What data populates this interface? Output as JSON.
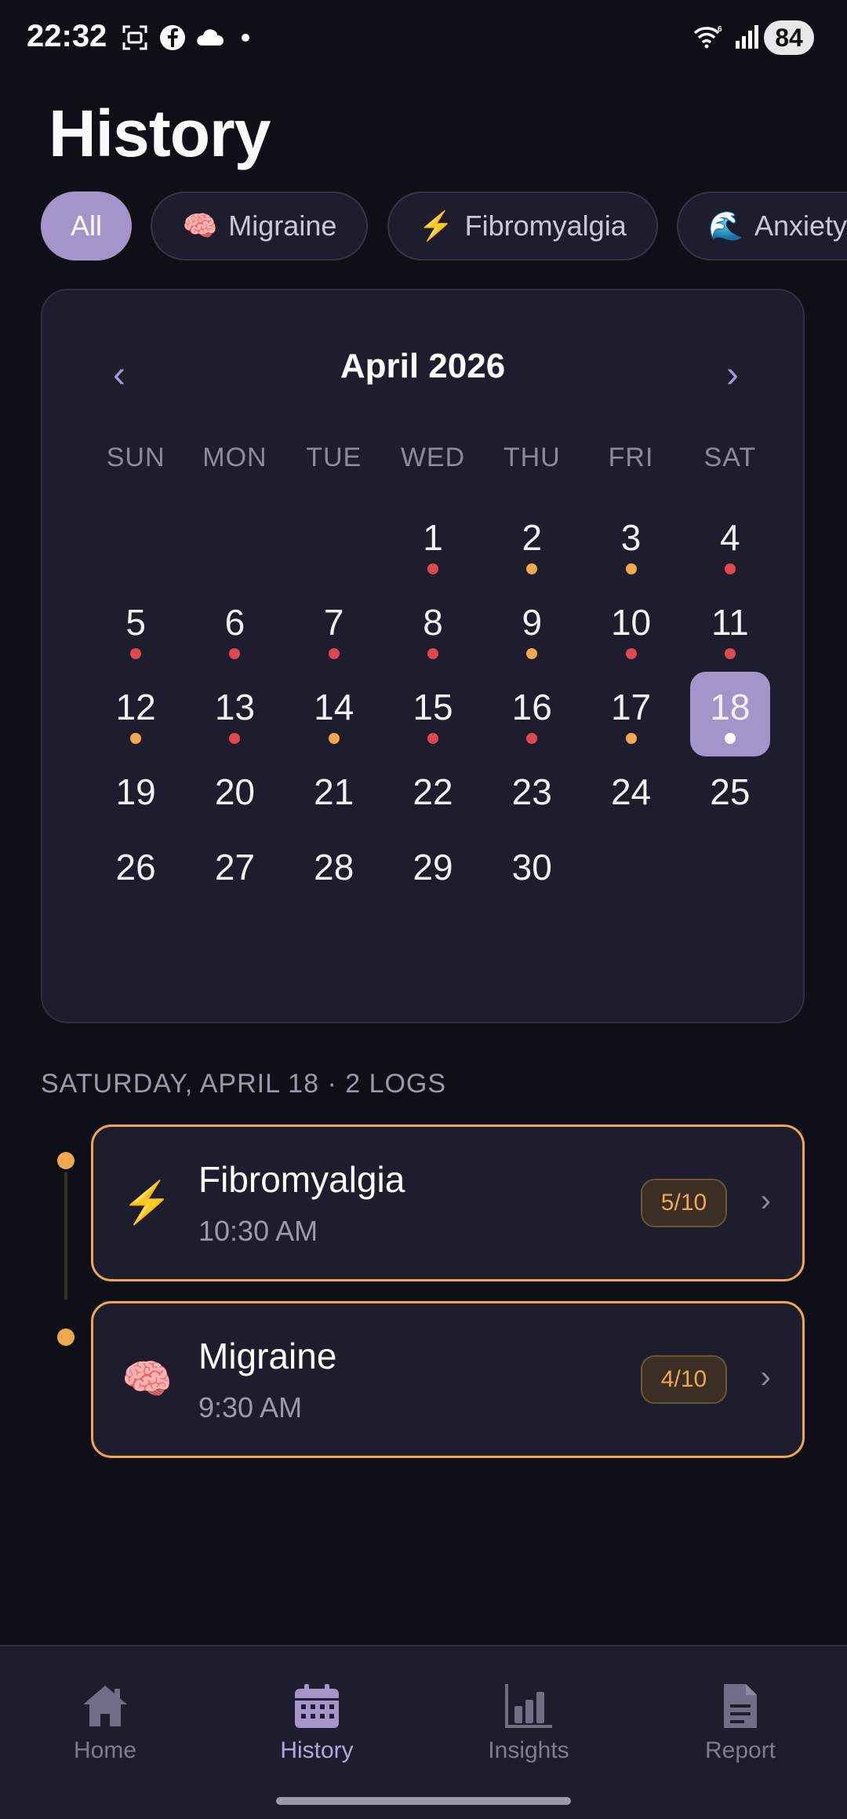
{
  "status_bar": {
    "time": "22:32",
    "battery": "84",
    "icons": [
      "screenshot-icon",
      "facebook-icon",
      "cloud-icon",
      "dot-icon",
      "wifi-6-icon",
      "signal-icon"
    ]
  },
  "page": {
    "title": "History"
  },
  "filters": [
    {
      "label": "All",
      "emoji": "",
      "active": true
    },
    {
      "label": "Migraine",
      "emoji": "🧠",
      "active": false
    },
    {
      "label": "Fibromyalgia",
      "emoji": "⚡",
      "active": false
    },
    {
      "label": "Anxiety",
      "emoji": "🌊",
      "active": false
    }
  ],
  "calendar": {
    "month": "April 2026",
    "prev": "‹",
    "next": "›",
    "weekdays": [
      "SUN",
      "MON",
      "TUE",
      "WED",
      "THU",
      "FRI",
      "SAT"
    ],
    "selected_day": "18",
    "weeks": [
      [
        {
          "d": ""
        },
        {
          "d": ""
        },
        {
          "d": ""
        },
        {
          "d": "1",
          "dot": "red"
        },
        {
          "d": "2",
          "dot": "orange"
        },
        {
          "d": "3",
          "dot": "orange"
        },
        {
          "d": "4",
          "dot": "red"
        }
      ],
      [
        {
          "d": "5",
          "dot": "red"
        },
        {
          "d": "6",
          "dot": "red"
        },
        {
          "d": "7",
          "dot": "red"
        },
        {
          "d": "8",
          "dot": "red"
        },
        {
          "d": "9",
          "dot": "orange"
        },
        {
          "d": "10",
          "dot": "red"
        },
        {
          "d": "11",
          "dot": "red"
        }
      ],
      [
        {
          "d": "12",
          "dot": "orange"
        },
        {
          "d": "13",
          "dot": "red"
        },
        {
          "d": "14",
          "dot": "orange"
        },
        {
          "d": "15",
          "dot": "red"
        },
        {
          "d": "16",
          "dot": "red"
        },
        {
          "d": "17",
          "dot": "orange"
        },
        {
          "d": "18",
          "dot": "white",
          "selected": true
        }
      ],
      [
        {
          "d": "19"
        },
        {
          "d": "20"
        },
        {
          "d": "21"
        },
        {
          "d": "22"
        },
        {
          "d": "23"
        },
        {
          "d": "24"
        },
        {
          "d": "25"
        }
      ],
      [
        {
          "d": "26"
        },
        {
          "d": "27"
        },
        {
          "d": "28"
        },
        {
          "d": "29"
        },
        {
          "d": "30"
        },
        {
          "d": ""
        },
        {
          "d": ""
        }
      ]
    ]
  },
  "colors": {
    "accent": "#a394c9",
    "red": "#e0474f",
    "orange": "#f0a84a",
    "white": "#ffffff",
    "card": "#1d1d2e",
    "background": "#0f0f17"
  },
  "day_section": {
    "label": "SATURDAY, APRIL 18 · 2 LOGS"
  },
  "logs": [
    {
      "icon": "⚡",
      "icon_name": "lightning-icon",
      "name": "Fibromyalgia",
      "time": "10:30 AM",
      "score": "5/10",
      "chevron": "›"
    },
    {
      "icon": "🧠",
      "icon_name": "brain-icon",
      "name": "Migraine",
      "time": "9:30 AM",
      "score": "4/10",
      "chevron": "›"
    }
  ],
  "nav": {
    "items": [
      {
        "label": "Home",
        "icon": "home-icon",
        "active": false
      },
      {
        "label": "History",
        "icon": "calendar-icon",
        "active": true
      },
      {
        "label": "Insights",
        "icon": "bar-chart-icon",
        "active": false
      },
      {
        "label": "Report",
        "icon": "document-icon",
        "active": false
      }
    ]
  }
}
